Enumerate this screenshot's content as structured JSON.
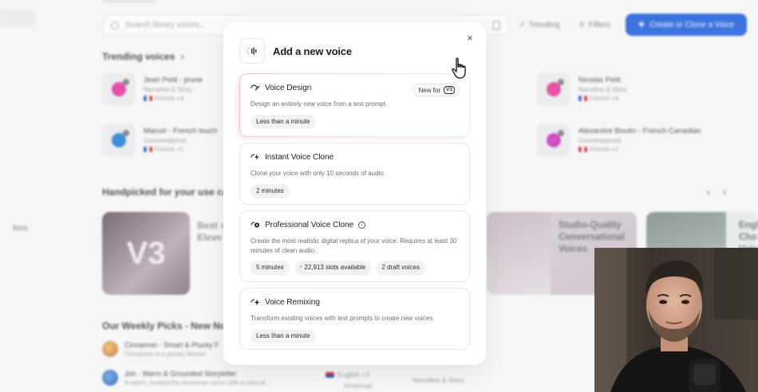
{
  "background": {
    "search_placeholder": "Search library voices...",
    "trending_btn": "Trending",
    "filters_btn": "Filters",
    "create_btn": "Create or Clone a Voice",
    "beta_label": "Beta",
    "trending_heading": "Trending voices",
    "voices": [
      {
        "name": "Jean Petit - jeune",
        "sub": "Narrative & Story",
        "lang": "French +4",
        "color": "#e84fa6"
      },
      {
        "name": "Marcel - French touch",
        "sub": "Conversational",
        "lang": "French +1",
        "color": "#3a8fd6"
      },
      {
        "name": "Nicolas Petit",
        "sub": "Narrative & Story",
        "lang": "French +4",
        "color": "#e84fa6"
      },
      {
        "name": "Alexandre Boutin - French Canadian",
        "sub": "Conversational",
        "lang": "French +1",
        "color": "#d14fc4"
      }
    ],
    "handpicked_heading": "Handpicked for your use ca",
    "card_v3_label": "V3",
    "card_best_text": "Best o\nEleve",
    "card_studio_text": "Studio-Quality\nConversational\nVoices",
    "card_eng_text": "Engl\nCho\nVoic",
    "weekly_heading": "Our Weekly Picks - New No",
    "picks": [
      {
        "name": "Cinnamon - Smart & Plucky F",
        "sub": "Cinnamon is a plucky female"
      },
      {
        "name": "Jon - Warm & Grounded Storyteller",
        "sub": "A warm, trustworthy American voice with a natural..."
      }
    ],
    "pick_lang": "English +3",
    "pick_accent": "American",
    "pick_category": "Narrative & Story"
  },
  "modal": {
    "title": "Add a new voice",
    "close_glyph": "×",
    "options": [
      {
        "title": "Voice Design",
        "badge": "New for",
        "badge_tag": "V3",
        "desc": "Design an entirely new voice from a text prompt.",
        "chips": [
          "Less than a minute"
        ]
      },
      {
        "title": "Instant Voice Clone",
        "desc": "Clone your voice with only 10 seconds of audio.",
        "chips": [
          "2 minutes"
        ]
      },
      {
        "title": "Professional Voice Clone",
        "info_glyph": "i",
        "desc": "Create the most realistic digital replica of your voice. Requires at least 30 minutes of clean audio.",
        "chips": [
          "5 minutes",
          "22,913 slots available",
          "2 draft voices"
        ]
      },
      {
        "title": "Voice Remixing",
        "desc": "Transform existing voices with text prompts to create new voices.",
        "chips": [
          "Less than a minute"
        ]
      }
    ]
  },
  "colors": {
    "accent_blue": "#3d74e0",
    "active_gradient_pink": "#f4c0c9"
  }
}
